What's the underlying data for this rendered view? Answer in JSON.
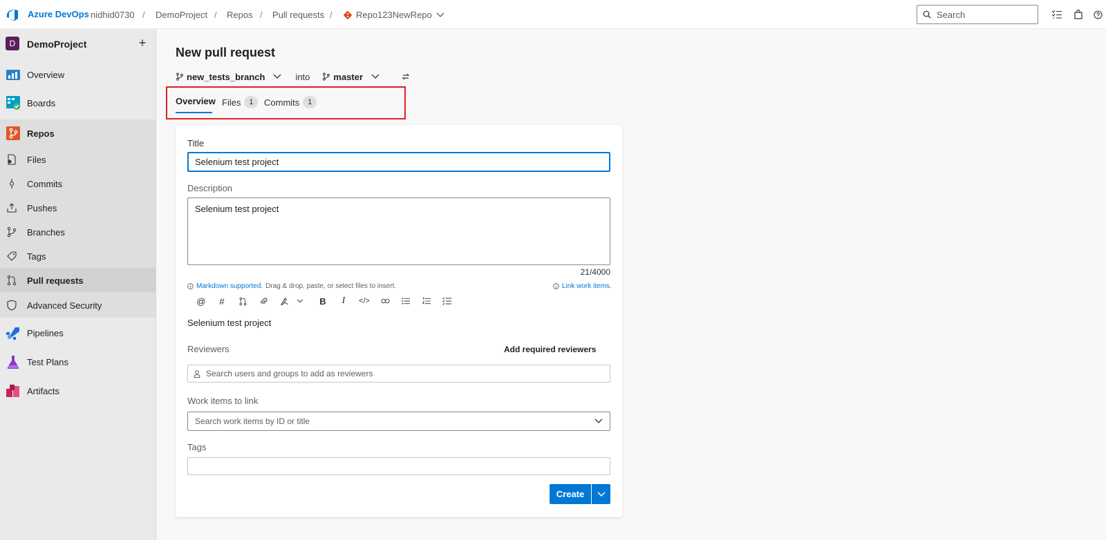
{
  "header": {
    "brand": "Azure DevOps",
    "breadcrumbs": [
      "nidhid0730",
      "DemoProject",
      "Repos",
      "Pull requests"
    ],
    "repo": "Repo123NewRepo",
    "search_placeholder": "Search"
  },
  "sidebar": {
    "project_initial": "D",
    "project_name": "DemoProject",
    "items": [
      {
        "label": "Overview",
        "icon": "overview-icon"
      },
      {
        "label": "Boards",
        "icon": "boards-icon"
      },
      {
        "label": "Repos",
        "icon": "repos-icon"
      },
      {
        "label": "Files",
        "icon": "files-icon"
      },
      {
        "label": "Commits",
        "icon": "commits-icon"
      },
      {
        "label": "Pushes",
        "icon": "pushes-icon"
      },
      {
        "label": "Branches",
        "icon": "branches-icon"
      },
      {
        "label": "Tags",
        "icon": "tags-icon"
      },
      {
        "label": "Pull requests",
        "icon": "pull-requests-icon"
      },
      {
        "label": "Advanced Security",
        "icon": "shield-icon"
      },
      {
        "label": "Pipelines",
        "icon": "pipelines-icon"
      },
      {
        "label": "Test Plans",
        "icon": "test-plans-icon"
      },
      {
        "label": "Artifacts",
        "icon": "artifacts-icon"
      }
    ]
  },
  "main": {
    "title": "New pull request",
    "source_branch": "new_tests_branch",
    "into_label": "into",
    "target_branch": "master",
    "tabs": [
      {
        "label": "Overview"
      },
      {
        "label": "Files",
        "count": "1"
      },
      {
        "label": "Commits",
        "count": "1"
      }
    ],
    "form": {
      "title_label": "Title",
      "title_value": "Selenium test project",
      "description_label": "Description",
      "description_value": "Selenium test project",
      "char_counter": "21/4000",
      "markdown_link": "Markdown supported.",
      "markdown_hint": "Drag & drop, paste, or select files to insert.",
      "link_work_items": "Link work items.",
      "preview_text": "Selenium test project",
      "reviewers_label": "Reviewers",
      "add_required_reviewers": "Add required reviewers",
      "reviewers_placeholder": "Search users and groups to add as reviewers",
      "work_items_label": "Work items to link",
      "work_items_placeholder": "Search work items by ID or title",
      "tags_label": "Tags",
      "create_label": "Create"
    }
  },
  "colors": {
    "accent": "#0078d4",
    "highlight_box": "#e02020",
    "project_avatar": "#5c1e5c"
  }
}
